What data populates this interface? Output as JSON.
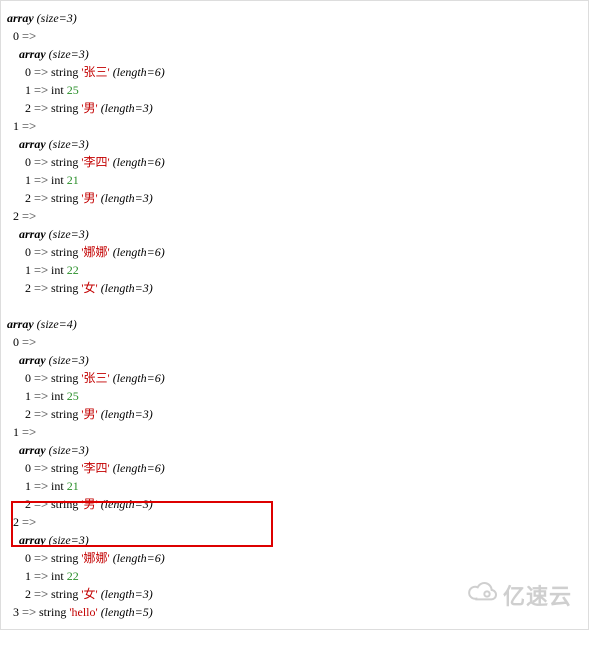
{
  "keywords": {
    "array": "array",
    "size_prefix": "(size=",
    "size_suffix": ")",
    "arrow": "=>",
    "string_type": "string",
    "int_type": "int",
    "length_prefix": "(length=",
    "length_suffix": ")"
  },
  "dumps": [
    {
      "size": 3,
      "items": [
        {
          "key": 0,
          "type": "array",
          "size": 3,
          "items": [
            {
              "key": 0,
              "type": "string",
              "value": "张三",
              "length": 6
            },
            {
              "key": 1,
              "type": "int",
              "value": 25
            },
            {
              "key": 2,
              "type": "string",
              "value": "男",
              "length": 3
            }
          ]
        },
        {
          "key": 1,
          "type": "array",
          "size": 3,
          "items": [
            {
              "key": 0,
              "type": "string",
              "value": "李四",
              "length": 6
            },
            {
              "key": 1,
              "type": "int",
              "value": 21
            },
            {
              "key": 2,
              "type": "string",
              "value": "男",
              "length": 3
            }
          ]
        },
        {
          "key": 2,
          "type": "array",
          "size": 3,
          "items": [
            {
              "key": 0,
              "type": "string",
              "value": "娜娜",
              "length": 6
            },
            {
              "key": 1,
              "type": "int",
              "value": 22
            },
            {
              "key": 2,
              "type": "string",
              "value": "女",
              "length": 3
            }
          ]
        }
      ]
    },
    {
      "size": 4,
      "items": [
        {
          "key": 0,
          "type": "array",
          "size": 3,
          "items": [
            {
              "key": 0,
              "type": "string",
              "value": "张三",
              "length": 6
            },
            {
              "key": 1,
              "type": "int",
              "value": 25
            },
            {
              "key": 2,
              "type": "string",
              "value": "男",
              "length": 3
            }
          ]
        },
        {
          "key": 1,
          "type": "array",
          "size": 3,
          "items": [
            {
              "key": 0,
              "type": "string",
              "value": "李四",
              "length": 6
            },
            {
              "key": 1,
              "type": "int",
              "value": 21
            },
            {
              "key": 2,
              "type": "string",
              "value": "男",
              "length": 3
            }
          ]
        },
        {
          "key": 2,
          "type": "array",
          "size": 3,
          "items": [
            {
              "key": 0,
              "type": "string",
              "value": "娜娜",
              "length": 6
            },
            {
              "key": 1,
              "type": "int",
              "value": 22
            },
            {
              "key": 2,
              "type": "string",
              "value": "女",
              "length": 3
            }
          ]
        },
        {
          "key": 3,
          "type": "string",
          "value": "hello",
          "length": 5
        }
      ]
    }
  ],
  "highlight": {
    "dump_index": 1,
    "item_key": 3
  },
  "watermark": {
    "text": "亿速云"
  }
}
